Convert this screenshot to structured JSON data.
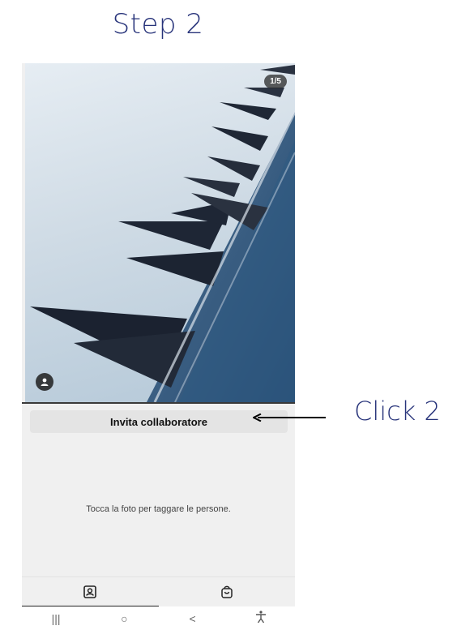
{
  "annotation": {
    "step_title": "Step 2",
    "click_label": "Click 2",
    "accent_color": "#27337a"
  },
  "photo": {
    "counter": "1/5",
    "tag_icon": "user-icon"
  },
  "tag_screen": {
    "invite_button_label": "Invita collaboratore",
    "hint_text": "Tocca la foto per taggare le persone."
  },
  "tabs": [
    {
      "icon": "person-tag-icon",
      "active": true
    },
    {
      "icon": "shopping-bag-icon",
      "active": false
    }
  ],
  "system_nav": {
    "recent": "|||",
    "home": "○",
    "back": "<",
    "accessibility": "accessibility-icon"
  }
}
